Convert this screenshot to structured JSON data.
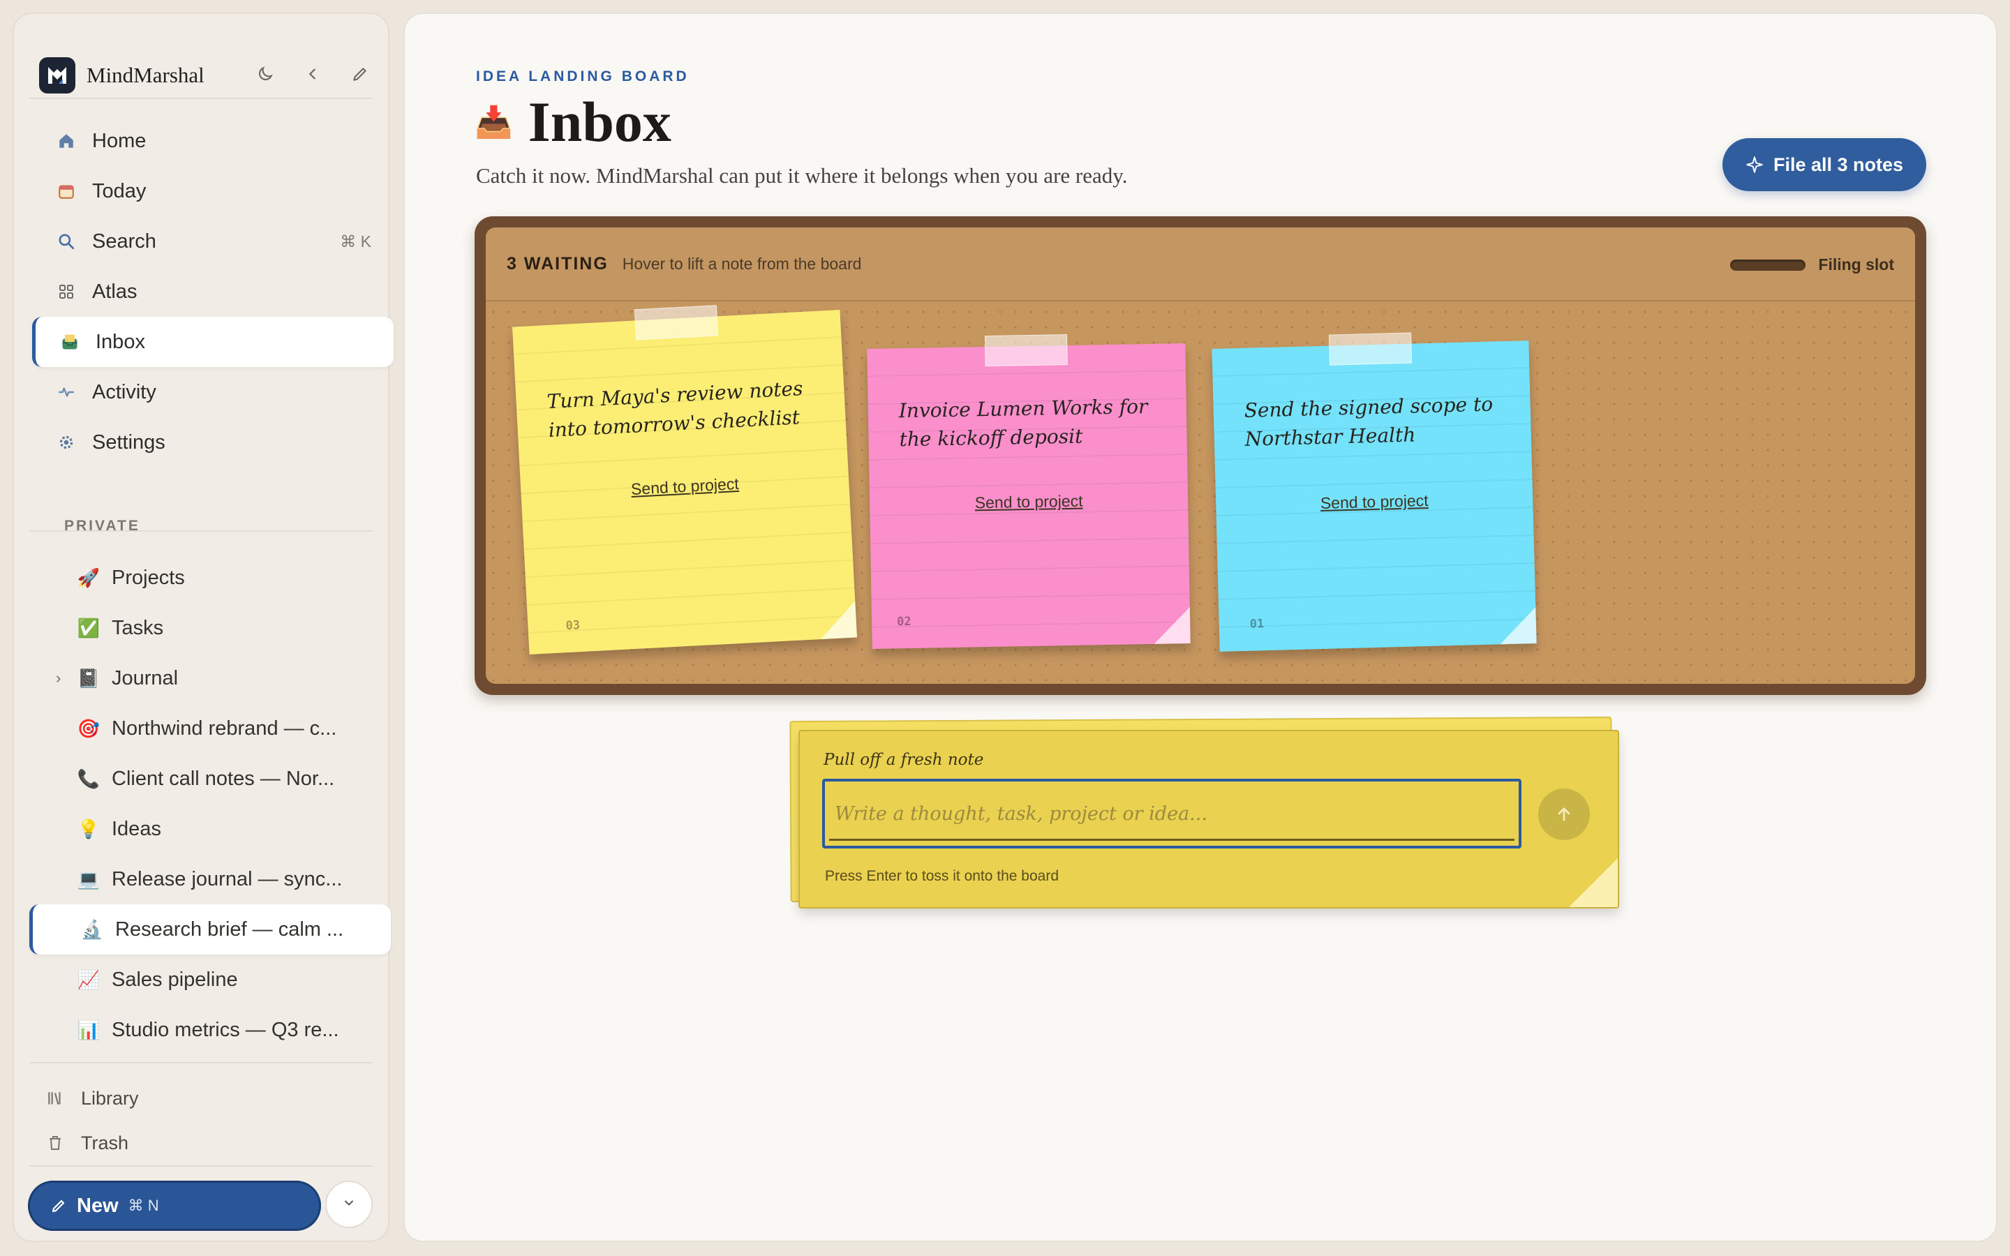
{
  "app": {
    "name": "MindMarshal"
  },
  "sidebar": {
    "nav": [
      {
        "label": "Home",
        "icon": "home-icon"
      },
      {
        "label": "Today",
        "icon": "calendar-icon"
      },
      {
        "label": "Search",
        "icon": "search-icon",
        "shortcut": "⌘ K"
      },
      {
        "label": "Atlas",
        "icon": "grid-icon"
      },
      {
        "label": "Inbox",
        "icon": "inbox-icon",
        "active": true
      },
      {
        "label": "Activity",
        "icon": "activity-icon"
      },
      {
        "label": "Settings",
        "icon": "gear-icon"
      }
    ],
    "section_label": "PRIVATE",
    "pages": [
      {
        "label": "Projects",
        "emoji": "🚀"
      },
      {
        "label": "Tasks",
        "emoji": "✅"
      },
      {
        "label": "Journal",
        "emoji": "📓"
      },
      {
        "label": "Northwind rebrand — c...",
        "emoji": "🎯"
      },
      {
        "label": "Client call notes — Nor...",
        "emoji": "📞"
      },
      {
        "label": "Ideas",
        "emoji": "💡"
      },
      {
        "label": "Release journal — sync...",
        "emoji": "💻"
      },
      {
        "label": "Research brief — calm ...",
        "emoji": "🔬",
        "active": true
      },
      {
        "label": "Sales pipeline",
        "emoji": "📈"
      },
      {
        "label": "Studio metrics — Q3 re...",
        "emoji": "📊"
      }
    ],
    "footer": [
      {
        "label": "Library",
        "icon": "library-icon"
      },
      {
        "label": "Trash",
        "icon": "trash-icon"
      }
    ],
    "new_button": {
      "label": "New",
      "shortcut": "⌘ N"
    }
  },
  "main": {
    "eyebrow": "IDEA LANDING BOARD",
    "title": "Inbox",
    "title_emoji": "📥",
    "subtitle": "Catch it now. MindMarshal can put it where it belongs when you are ready.",
    "file_all_button": "File all 3 notes",
    "board": {
      "waiting": "3 WAITING",
      "hint": "Hover to lift a note from the board",
      "slot_label": "Filing slot",
      "notes": [
        {
          "text": "Turn Maya's review notes into tomorrow's checklist",
          "action": "Send to project",
          "num": "03",
          "color": "#fcee74"
        },
        {
          "text": "Invoice Lumen Works for the kickoff deposit",
          "action": "Send to project",
          "num": "02",
          "color": "#fb8fcc"
        },
        {
          "text": "Send the signed scope to Northstar Health",
          "action": "Send to project",
          "num": "01",
          "color": "#74e2fb"
        }
      ]
    },
    "composer": {
      "label": "Pull off a fresh note",
      "placeholder": "Write a thought, task, project or idea...",
      "value": "",
      "hint": "Press Enter to toss it onto the board"
    }
  },
  "colors": {
    "accent": "#2c5aa0",
    "board_frame": "#6d4a30",
    "cork": "#c6965f"
  }
}
